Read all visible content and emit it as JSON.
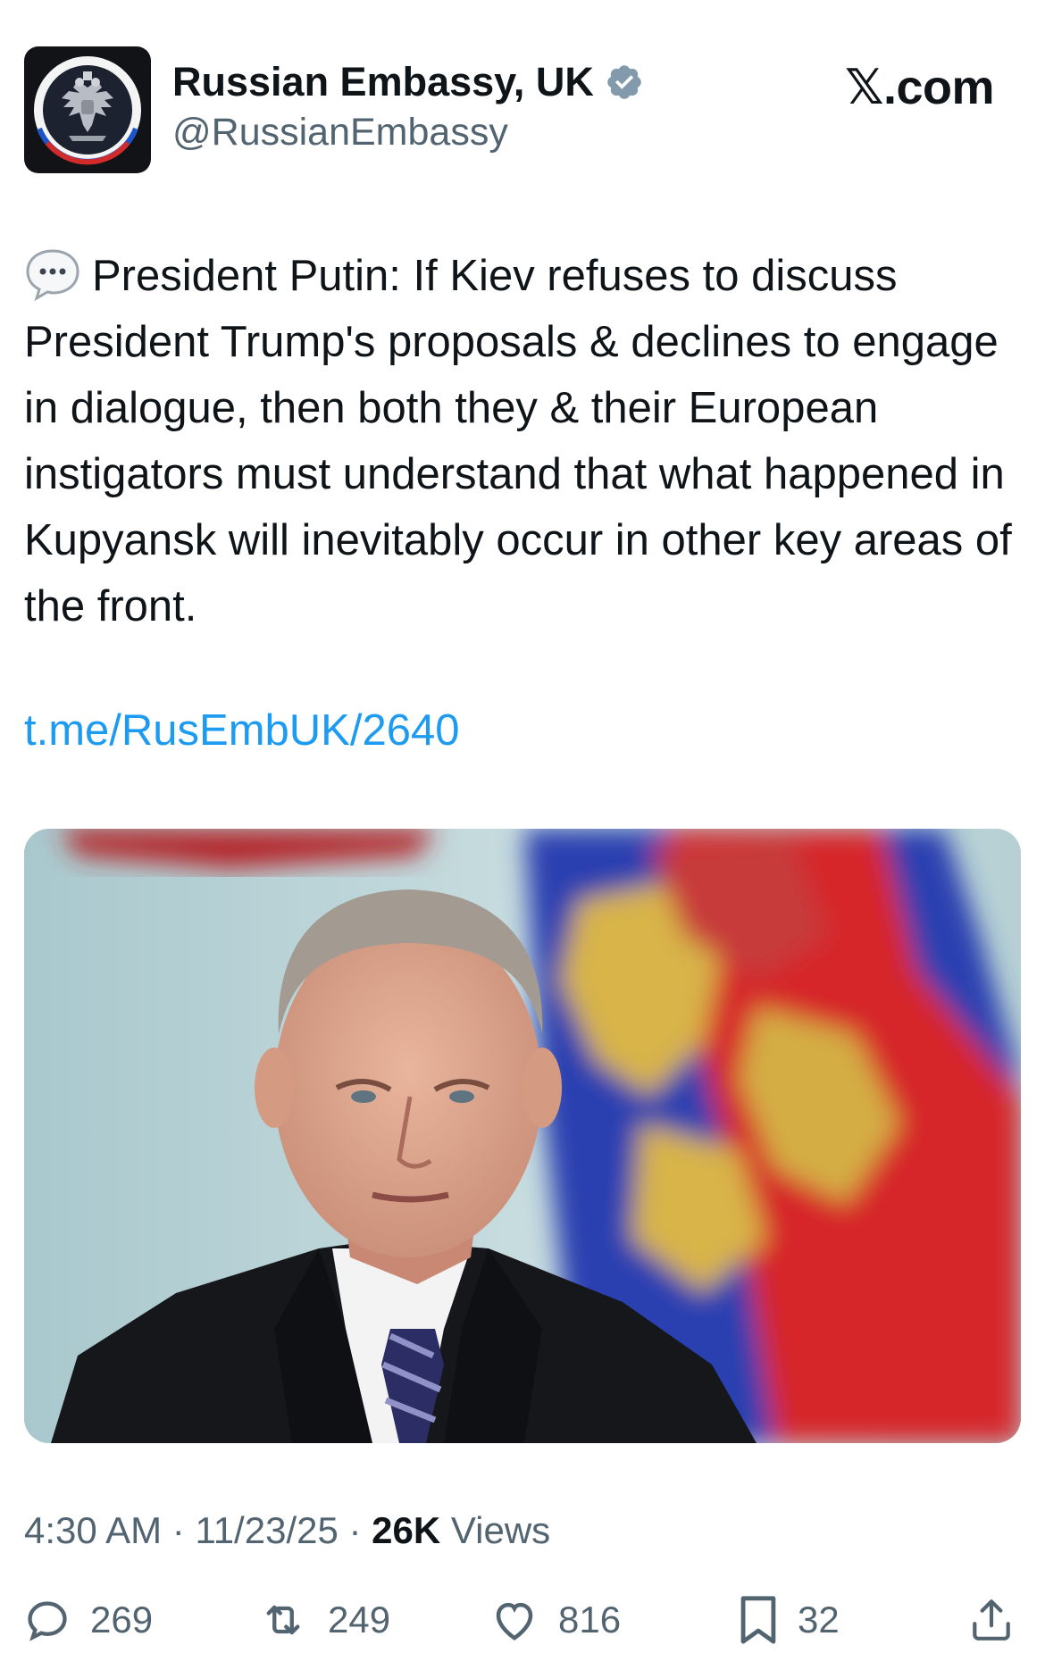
{
  "account": {
    "display_name": "Russian Embassy, UK",
    "handle": "@RussianEmbassy",
    "verified": true,
    "avatar_icon": "double-headed-eagle-emblem-icon"
  },
  "brand": {
    "label": "𝕏.com"
  },
  "tweet": {
    "emoji_icon": "speech-balloon-icon",
    "text": "President Putin: If Kiev refuses to discuss President Trump's proposals & declines to engage in dialogue, then both they & their European instigators must understand that what happened in Kupyansk will inevitably occur in other key areas of the front.",
    "link": "t.me/RusEmbUK/2640",
    "media_icon": "photo-portrait-with-flag-icon"
  },
  "meta": {
    "time": "4:30 AM",
    "separator": "·",
    "date": "11/23/25",
    "views_count": "26K",
    "views_label": "Views"
  },
  "actions": {
    "replies": "269",
    "reposts": "249",
    "likes": "816",
    "bookmarks": "32"
  },
  "colors": {
    "text": "#0f1419",
    "secondary": "#536471",
    "link": "#1d9bf0",
    "verified": "#829aab"
  }
}
